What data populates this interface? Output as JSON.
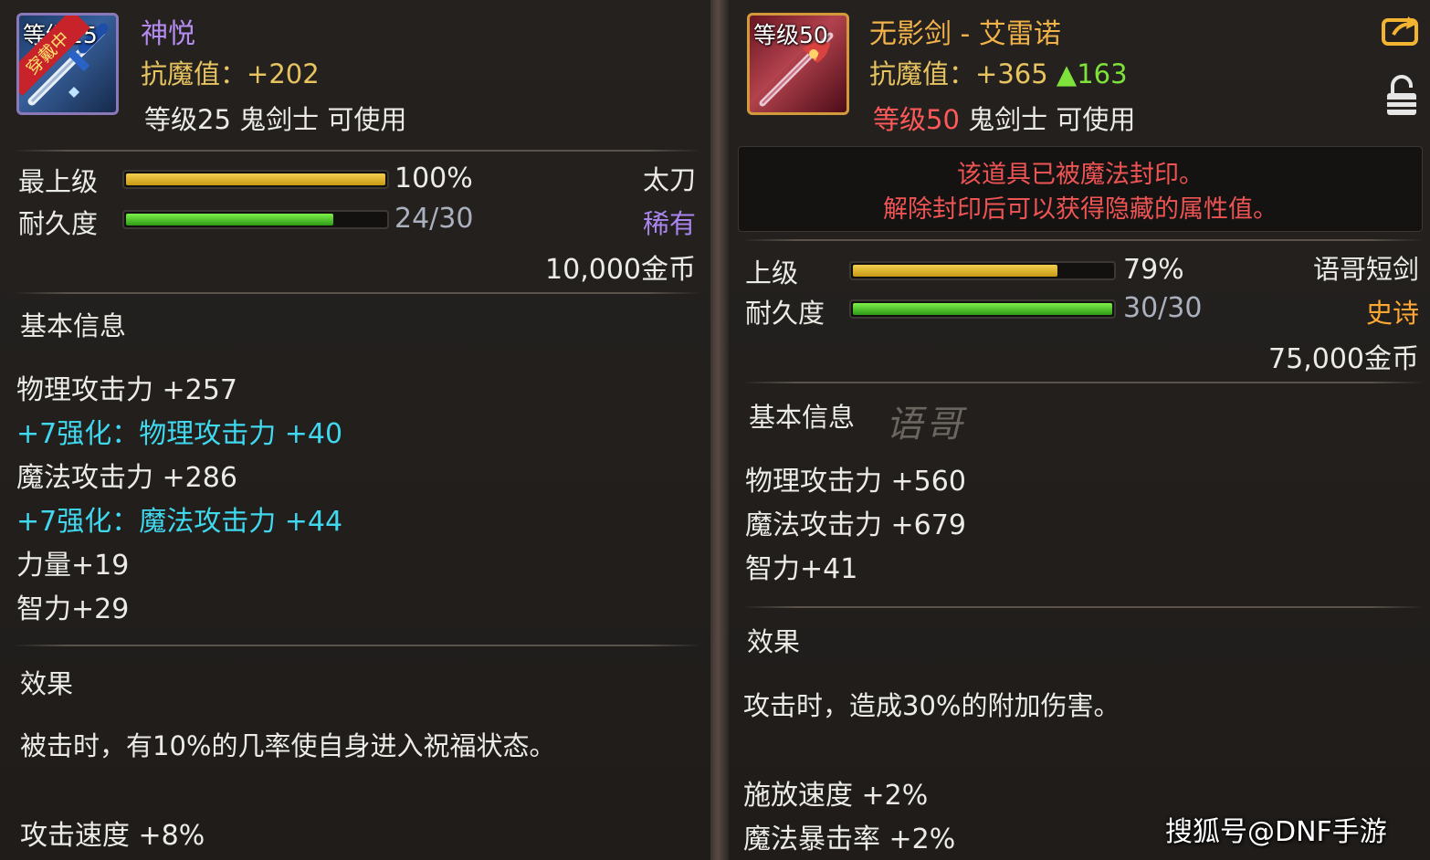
{
  "left_item": {
    "icon_level": "等级25",
    "icon_ribbon": "穿戴中",
    "name": "神悦",
    "anti_magic_label": "抗魔值：",
    "anti_magic_value": "+202",
    "requirement": "等级25 鬼剑士 可使用",
    "grade_label": "最上级",
    "grade_percent": "100%",
    "grade_fraction": 1.0,
    "durability_label": "耐久度",
    "durability_value": "24/30",
    "durability_fraction": 0.8,
    "weapon_type": "太刀",
    "rarity": "稀有",
    "price": "10,000金币",
    "section_basic": "基本信息",
    "stats": [
      {
        "text": "物理攻击力 +257",
        "color": "white"
      },
      {
        "text": "+7强化：物理攻击力 +40",
        "color": "cyan"
      },
      {
        "text": "魔法攻击力 +286",
        "color": "white"
      },
      {
        "text": "+7强化：魔法攻击力 +44",
        "color": "cyan"
      },
      {
        "text": "力量+19",
        "color": "white"
      },
      {
        "text": "智力+29",
        "color": "white"
      }
    ],
    "section_effect": "效果",
    "effect_text": "被击时，有10%的几率使自身进入祝福状态。",
    "extra_stat": "攻击速度 +8%"
  },
  "right_item": {
    "icon_level": "等级50",
    "name": "无影剑 - 艾雷诺",
    "anti_magic_label": "抗魔值：",
    "anti_magic_value": "+365",
    "anti_magic_diff": "▲163",
    "requirement_level": "等级50",
    "requirement_rest": " 鬼剑士 可使用",
    "seal_line1": "该道具已被魔法封印。",
    "seal_line2": "解除封印后可以获得隐藏的属性值。",
    "grade_label": "上级",
    "grade_percent": "79%",
    "grade_fraction": 0.79,
    "durability_label": "耐久度",
    "durability_value": "30/30",
    "durability_fraction": 1.0,
    "weapon_type": "语哥短剑",
    "rarity": "史诗",
    "price": "75,000金币",
    "section_basic": "基本信息",
    "signature": "语哥",
    "stats": [
      {
        "text": "物理攻击力 +560",
        "color": "white"
      },
      {
        "text": "魔法攻击力 +679",
        "color": "white"
      },
      {
        "text": "智力+41",
        "color": "white"
      }
    ],
    "section_effect": "效果",
    "effect_text": "攻击时，造成30%的附加伤害。",
    "extra_stats": [
      "施放速度 +2%",
      "魔法暴击率 +2%"
    ]
  },
  "source_credit": "搜狐号@DNF手游",
  "colors": {
    "rare": "#a985ee",
    "epic": "#ffa733",
    "enhance": "#3fd8ee",
    "anti_magic": "#e8c460",
    "upgrade": "#7ee23a",
    "sealed": "#ef5454"
  },
  "icons": [
    "share-icon",
    "lock-icon",
    "katana-icon",
    "dagger-icon"
  ]
}
